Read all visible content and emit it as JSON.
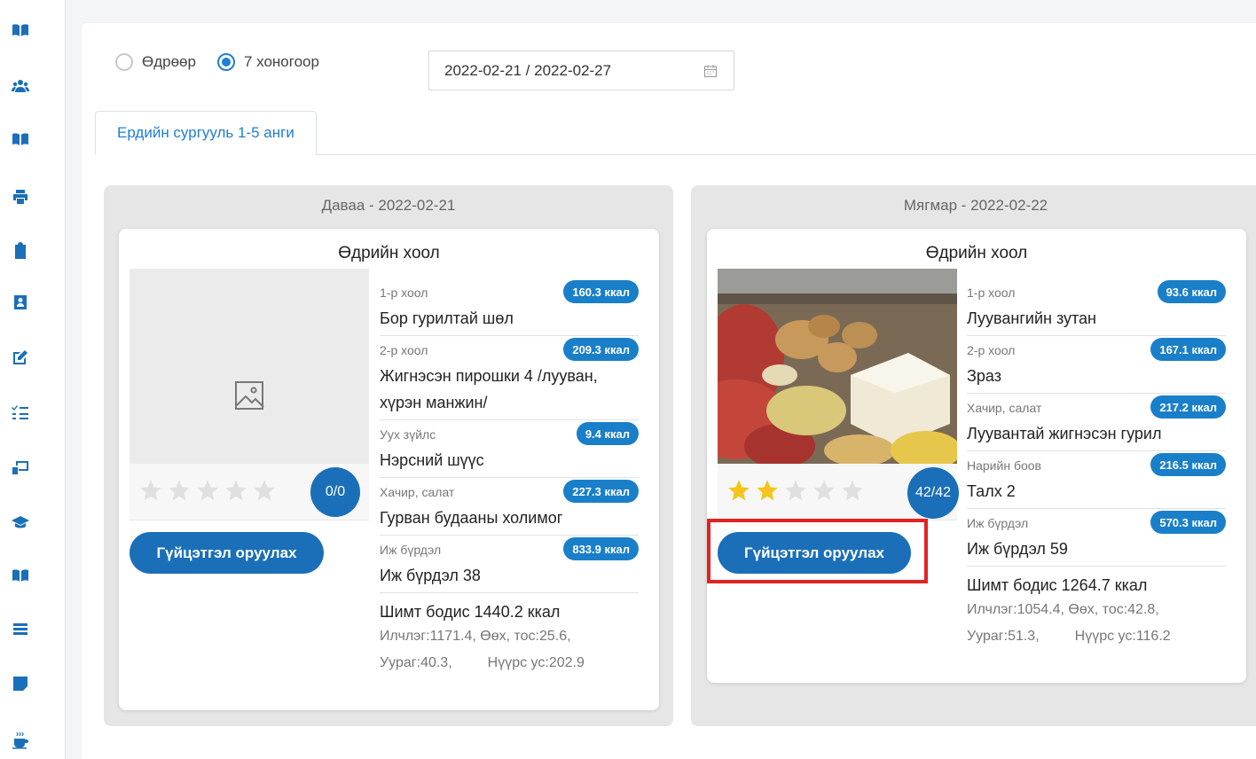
{
  "sidebar": {
    "icons": [
      "book-icon",
      "users-icon",
      "book-icon",
      "printer-icon",
      "clipboard-icon",
      "contact-card-icon",
      "edit-icon",
      "checklist-icon",
      "monitor-icon",
      "graduation-cap-icon",
      "book-icon",
      "menu-lines-icon",
      "sticky-note-icon",
      "coffee-cup-icon"
    ]
  },
  "filter": {
    "options": [
      {
        "label": "Өдрөөр",
        "checked": false
      },
      {
        "label": "7 хоногоор",
        "checked": true
      }
    ],
    "date_range": "2022-02-21 / 2022-02-27"
  },
  "tabs": [
    {
      "label": "Ердийн сургууль 1-5 анги",
      "active": true
    }
  ],
  "days": [
    {
      "header": "Даваа - 2022-02-21",
      "card_title": "Өдрийн хоол",
      "has_photo": false,
      "rating_text": "0/0",
      "stars_filled": 0,
      "button_label": "Гүйцэтгэл оруулах",
      "meals": [
        {
          "category": "1-р хоол",
          "kcal": "160.3 ккал",
          "name": "Бор гурилтай шөл"
        },
        {
          "category": "2-р хоол",
          "kcal": "209.3 ккал",
          "name": "Жигнэсэн пирошки 4 /лууван, хүрэн манжин/"
        },
        {
          "category": "Уух зүйлс",
          "kcal": "9.4 ккал",
          "name": "Нэрсний шүүс"
        },
        {
          "category": "Хачир, салат",
          "kcal": "227.3 ккал",
          "name": "Гурван будааны холимог"
        },
        {
          "category": "Иж бүрдэл",
          "kcal": "833.9 ккал",
          "name": "Иж бүрдэл 38"
        }
      ],
      "nutrition_total": "Шимт бодис 1440.2 ккал",
      "nutrition_line1": "Илчлэг:1171.4, Өөх, тос:25.6,",
      "nutrition_line2_a": "Уураг:40.3,",
      "nutrition_line2_b": "Нүүрс ус:202.9"
    },
    {
      "header": "Мягмар - 2022-02-22",
      "card_title": "Өдрийн хоол",
      "has_photo": true,
      "rating_text": "42/42",
      "stars_filled": 2,
      "button_label": "Гүйцэтгэл оруулах",
      "meals": [
        {
          "category": "1-р хоол",
          "kcal": "93.6 ккал",
          "name": "Луувангийн зутан"
        },
        {
          "category": "2-р хоол",
          "kcal": "167.1 ккал",
          "name": "Зраз"
        },
        {
          "category": "Хачир, салат",
          "kcal": "217.2 ккал",
          "name": "Луувантай жигнэсэн гурил"
        },
        {
          "category": "Нарийн боов",
          "kcal": "216.5 ккал",
          "name": "Талх 2"
        },
        {
          "category": "Иж бүрдэл",
          "kcal": "570.3 ккал",
          "name": "Иж бүрдэл 59"
        }
      ],
      "nutrition_total": "Шимт бодис 1264.7 ккал",
      "nutrition_line1": "Илчлэг:1054.4, Өөх, тос:42.8,",
      "nutrition_line2_a": "Уураг:51.3,",
      "nutrition_line2_b": "Нүүрс ус:116.2"
    }
  ],
  "colors": {
    "primary": "#1a6fb8",
    "badge": "#1a7fc9",
    "highlight": "#e32222",
    "star_filled": "#f5c518",
    "star_empty": "#e0e0e0"
  }
}
